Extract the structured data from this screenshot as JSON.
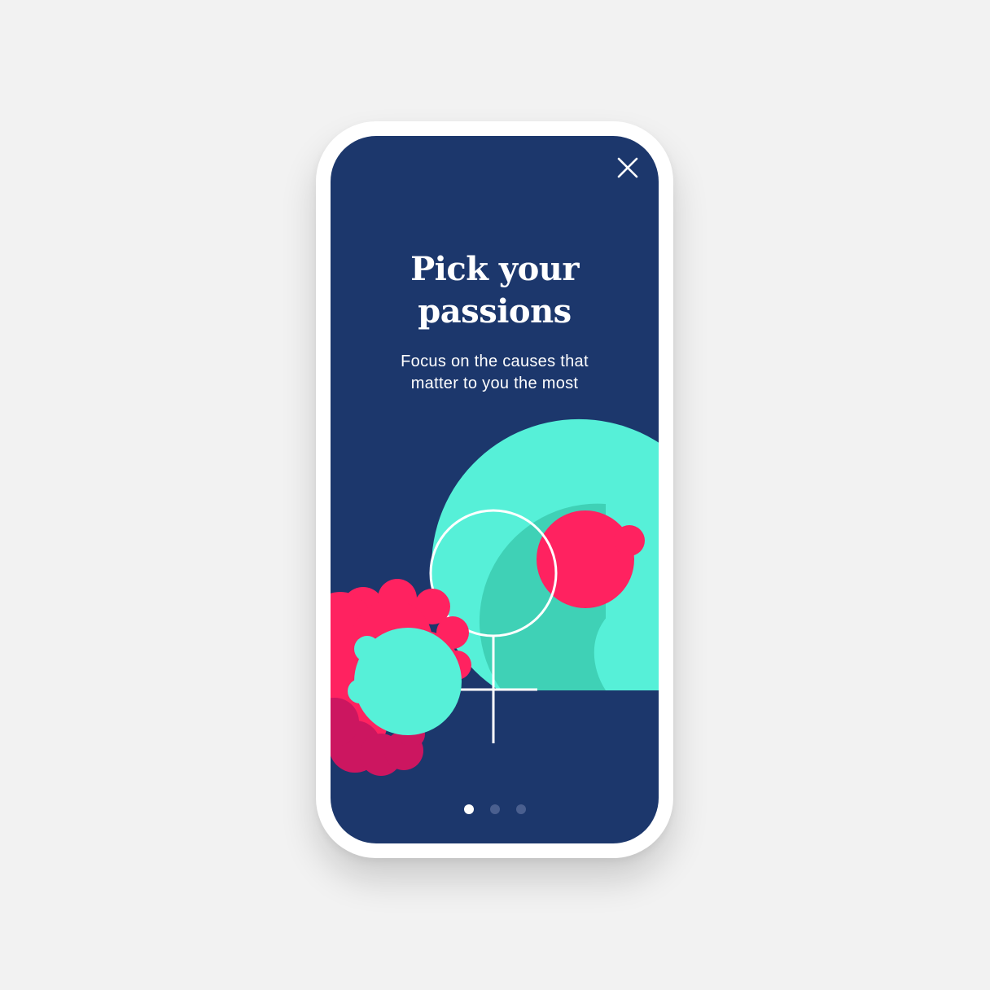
{
  "onboarding": {
    "title_line1": "Pick your",
    "title_line2": "passions",
    "subtitle_line1": "Focus on the causes that",
    "subtitle_line2": "matter to you the most",
    "close_icon": "close-icon",
    "pagination": {
      "total": 3,
      "active_index": 0
    }
  },
  "colors": {
    "page_background": "#f2f2f2",
    "screen_background": "#1c376c",
    "teal": "#56f0d8",
    "teal_dark": "#3fd1b6",
    "pink": "#ff2260",
    "pink_dark": "#cc1660",
    "white": "#ffffff"
  }
}
